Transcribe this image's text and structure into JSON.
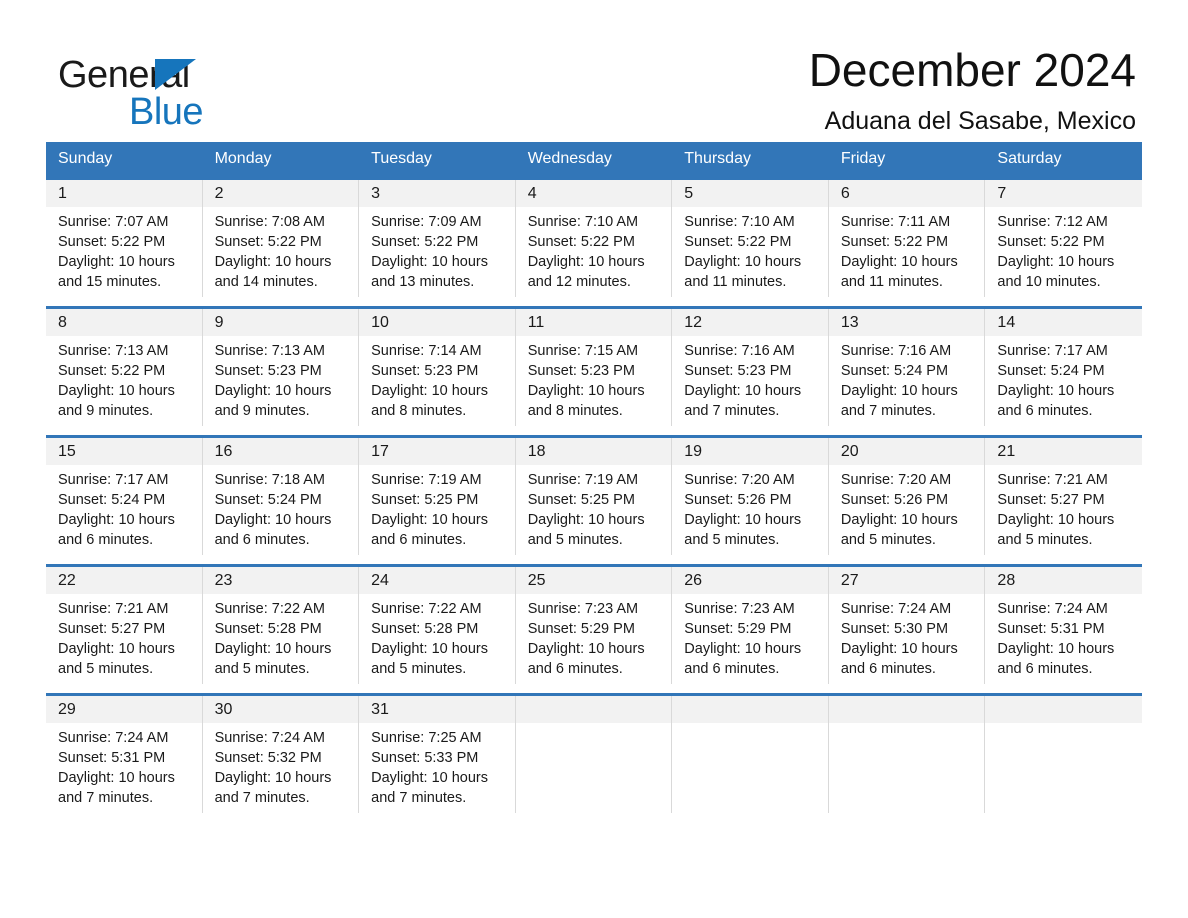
{
  "brand": {
    "name_part1": "General",
    "name_part2": "Blue",
    "flag_icon": "blue-triangle-flag-icon"
  },
  "header": {
    "title": "December 2024",
    "subtitle": "Aduana del Sasabe, Mexico"
  },
  "colors": {
    "header_blue": "#3276b8",
    "brand_blue": "#1675bc",
    "day_band_gray": "#f2f2f2",
    "cell_border": "#d9d9d9",
    "text": "#1a1a1a"
  },
  "weekdays": [
    "Sunday",
    "Monday",
    "Tuesday",
    "Wednesday",
    "Thursday",
    "Friday",
    "Saturday"
  ],
  "weeks": [
    [
      {
        "day": "1",
        "sunrise": "Sunrise: 7:07 AM",
        "sunset": "Sunset: 5:22 PM",
        "daylight_line1": "Daylight: 10 hours",
        "daylight_line2": "and 15 minutes."
      },
      {
        "day": "2",
        "sunrise": "Sunrise: 7:08 AM",
        "sunset": "Sunset: 5:22 PM",
        "daylight_line1": "Daylight: 10 hours",
        "daylight_line2": "and 14 minutes."
      },
      {
        "day": "3",
        "sunrise": "Sunrise: 7:09 AM",
        "sunset": "Sunset: 5:22 PM",
        "daylight_line1": "Daylight: 10 hours",
        "daylight_line2": "and 13 minutes."
      },
      {
        "day": "4",
        "sunrise": "Sunrise: 7:10 AM",
        "sunset": "Sunset: 5:22 PM",
        "daylight_line1": "Daylight: 10 hours",
        "daylight_line2": "and 12 minutes."
      },
      {
        "day": "5",
        "sunrise": "Sunrise: 7:10 AM",
        "sunset": "Sunset: 5:22 PM",
        "daylight_line1": "Daylight: 10 hours",
        "daylight_line2": "and 11 minutes."
      },
      {
        "day": "6",
        "sunrise": "Sunrise: 7:11 AM",
        "sunset": "Sunset: 5:22 PM",
        "daylight_line1": "Daylight: 10 hours",
        "daylight_line2": "and 11 minutes."
      },
      {
        "day": "7",
        "sunrise": "Sunrise: 7:12 AM",
        "sunset": "Sunset: 5:22 PM",
        "daylight_line1": "Daylight: 10 hours",
        "daylight_line2": "and 10 minutes."
      }
    ],
    [
      {
        "day": "8",
        "sunrise": "Sunrise: 7:13 AM",
        "sunset": "Sunset: 5:22 PM",
        "daylight_line1": "Daylight: 10 hours",
        "daylight_line2": "and 9 minutes."
      },
      {
        "day": "9",
        "sunrise": "Sunrise: 7:13 AM",
        "sunset": "Sunset: 5:23 PM",
        "daylight_line1": "Daylight: 10 hours",
        "daylight_line2": "and 9 minutes."
      },
      {
        "day": "10",
        "sunrise": "Sunrise: 7:14 AM",
        "sunset": "Sunset: 5:23 PM",
        "daylight_line1": "Daylight: 10 hours",
        "daylight_line2": "and 8 minutes."
      },
      {
        "day": "11",
        "sunrise": "Sunrise: 7:15 AM",
        "sunset": "Sunset: 5:23 PM",
        "daylight_line1": "Daylight: 10 hours",
        "daylight_line2": "and 8 minutes."
      },
      {
        "day": "12",
        "sunrise": "Sunrise: 7:16 AM",
        "sunset": "Sunset: 5:23 PM",
        "daylight_line1": "Daylight: 10 hours",
        "daylight_line2": "and 7 minutes."
      },
      {
        "day": "13",
        "sunrise": "Sunrise: 7:16 AM",
        "sunset": "Sunset: 5:24 PM",
        "daylight_line1": "Daylight: 10 hours",
        "daylight_line2": "and 7 minutes."
      },
      {
        "day": "14",
        "sunrise": "Sunrise: 7:17 AM",
        "sunset": "Sunset: 5:24 PM",
        "daylight_line1": "Daylight: 10 hours",
        "daylight_line2": "and 6 minutes."
      }
    ],
    [
      {
        "day": "15",
        "sunrise": "Sunrise: 7:17 AM",
        "sunset": "Sunset: 5:24 PM",
        "daylight_line1": "Daylight: 10 hours",
        "daylight_line2": "and 6 minutes."
      },
      {
        "day": "16",
        "sunrise": "Sunrise: 7:18 AM",
        "sunset": "Sunset: 5:24 PM",
        "daylight_line1": "Daylight: 10 hours",
        "daylight_line2": "and 6 minutes."
      },
      {
        "day": "17",
        "sunrise": "Sunrise: 7:19 AM",
        "sunset": "Sunset: 5:25 PM",
        "daylight_line1": "Daylight: 10 hours",
        "daylight_line2": "and 6 minutes."
      },
      {
        "day": "18",
        "sunrise": "Sunrise: 7:19 AM",
        "sunset": "Sunset: 5:25 PM",
        "daylight_line1": "Daylight: 10 hours",
        "daylight_line2": "and 5 minutes."
      },
      {
        "day": "19",
        "sunrise": "Sunrise: 7:20 AM",
        "sunset": "Sunset: 5:26 PM",
        "daylight_line1": "Daylight: 10 hours",
        "daylight_line2": "and 5 minutes."
      },
      {
        "day": "20",
        "sunrise": "Sunrise: 7:20 AM",
        "sunset": "Sunset: 5:26 PM",
        "daylight_line1": "Daylight: 10 hours",
        "daylight_line2": "and 5 minutes."
      },
      {
        "day": "21",
        "sunrise": "Sunrise: 7:21 AM",
        "sunset": "Sunset: 5:27 PM",
        "daylight_line1": "Daylight: 10 hours",
        "daylight_line2": "and 5 minutes."
      }
    ],
    [
      {
        "day": "22",
        "sunrise": "Sunrise: 7:21 AM",
        "sunset": "Sunset: 5:27 PM",
        "daylight_line1": "Daylight: 10 hours",
        "daylight_line2": "and 5 minutes."
      },
      {
        "day": "23",
        "sunrise": "Sunrise: 7:22 AM",
        "sunset": "Sunset: 5:28 PM",
        "daylight_line1": "Daylight: 10 hours",
        "daylight_line2": "and 5 minutes."
      },
      {
        "day": "24",
        "sunrise": "Sunrise: 7:22 AM",
        "sunset": "Sunset: 5:28 PM",
        "daylight_line1": "Daylight: 10 hours",
        "daylight_line2": "and 5 minutes."
      },
      {
        "day": "25",
        "sunrise": "Sunrise: 7:23 AM",
        "sunset": "Sunset: 5:29 PM",
        "daylight_line1": "Daylight: 10 hours",
        "daylight_line2": "and 6 minutes."
      },
      {
        "day": "26",
        "sunrise": "Sunrise: 7:23 AM",
        "sunset": "Sunset: 5:29 PM",
        "daylight_line1": "Daylight: 10 hours",
        "daylight_line2": "and 6 minutes."
      },
      {
        "day": "27",
        "sunrise": "Sunrise: 7:24 AM",
        "sunset": "Sunset: 5:30 PM",
        "daylight_line1": "Daylight: 10 hours",
        "daylight_line2": "and 6 minutes."
      },
      {
        "day": "28",
        "sunrise": "Sunrise: 7:24 AM",
        "sunset": "Sunset: 5:31 PM",
        "daylight_line1": "Daylight: 10 hours",
        "daylight_line2": "and 6 minutes."
      }
    ],
    [
      {
        "day": "29",
        "sunrise": "Sunrise: 7:24 AM",
        "sunset": "Sunset: 5:31 PM",
        "daylight_line1": "Daylight: 10 hours",
        "daylight_line2": "and 7 minutes."
      },
      {
        "day": "30",
        "sunrise": "Sunrise: 7:24 AM",
        "sunset": "Sunset: 5:32 PM",
        "daylight_line1": "Daylight: 10 hours",
        "daylight_line2": "and 7 minutes."
      },
      {
        "day": "31",
        "sunrise": "Sunrise: 7:25 AM",
        "sunset": "Sunset: 5:33 PM",
        "daylight_line1": "Daylight: 10 hours",
        "daylight_line2": "and 7 minutes."
      },
      {
        "day": "",
        "sunrise": "",
        "sunset": "",
        "daylight_line1": "",
        "daylight_line2": ""
      },
      {
        "day": "",
        "sunrise": "",
        "sunset": "",
        "daylight_line1": "",
        "daylight_line2": ""
      },
      {
        "day": "",
        "sunrise": "",
        "sunset": "",
        "daylight_line1": "",
        "daylight_line2": ""
      },
      {
        "day": "",
        "sunrise": "",
        "sunset": "",
        "daylight_line1": "",
        "daylight_line2": ""
      }
    ]
  ]
}
